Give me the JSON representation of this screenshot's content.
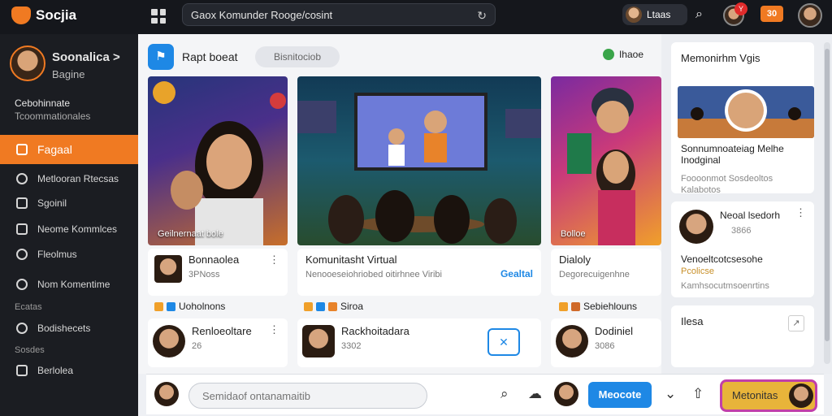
{
  "app": {
    "name": "Socjia",
    "address": "Gaox Komunder Rooge/cosint"
  },
  "topbar": {
    "live_label": "Ltaas",
    "notif_count": "Y",
    "coins": "30"
  },
  "profile": {
    "name": "Soonalica >",
    "sub": "Bagine",
    "head": "Cebohinnate",
    "head2": "Tcoommationales"
  },
  "nav": [
    {
      "label": "Fagaal",
      "icon": "home-icon"
    },
    {
      "label": "Metlooran Rtecsas",
      "icon": "group-icon"
    },
    {
      "label": "Sgoinil",
      "icon": "list-icon"
    },
    {
      "label": "Neome Kommlces",
      "icon": "community-icon"
    },
    {
      "label": "Fleolmus",
      "icon": "settings-icon"
    },
    {
      "label": "Nom Komentime",
      "icon": "globe-icon"
    }
  ],
  "side_sections": [
    {
      "title": "Ecatas",
      "item": "Bodishecets"
    },
    {
      "title": "Sosdes",
      "item": "Berlolea"
    }
  ],
  "main": {
    "title": "Rapt boeat",
    "pill": "Bisnitociob",
    "chip": "Ihaoe",
    "thumb_caption": "Geilnernaat bole",
    "thumb3_caption": "Bolloe",
    "cards": [
      {
        "title": "Bonnaolea",
        "sub": "3PNoss",
        "link": ""
      },
      {
        "title": "Komunitasht Virtual",
        "sub": "Nenooeseiohriobed oitirhnee Viribi",
        "link": "Gealtal"
      },
      {
        "title": "Dialoly",
        "sub": "Degorecuigenhne",
        "link": ""
      }
    ],
    "tags": [
      "Uoholnons",
      "Siroa",
      "Sebiehlouns"
    ],
    "friends": [
      {
        "name": "Renloeoltare",
        "sub": "26"
      },
      {
        "name": "Rackhoitadara",
        "sub": "3302"
      },
      {
        "name": "Dodiniel",
        "sub": "3086"
      }
    ]
  },
  "right": {
    "card1": {
      "title": "Memonirhm Vgis",
      "caption": "Sonnumnoateiag Melhe Inodginal",
      "sub1": "Foooonmot Sosdeoltos",
      "sub2": "Kalabotos"
    },
    "card2": {
      "name": "Neoal lsedorh",
      "meta": "3866",
      "caption": "Venoeltcotcsesohe",
      "sub1": "Pcolicse",
      "sub2": "Kamhsocutmsoenrtins"
    },
    "card3": {
      "title": "Ilesa"
    }
  },
  "bottombar": {
    "placeholder": "Semidaof ontanamaitib",
    "button": "Meocote",
    "button2": "Metonitas"
  },
  "colors": {
    "accent": "#f07a22",
    "primary": "#1e88e5",
    "dark": "#15171c"
  }
}
